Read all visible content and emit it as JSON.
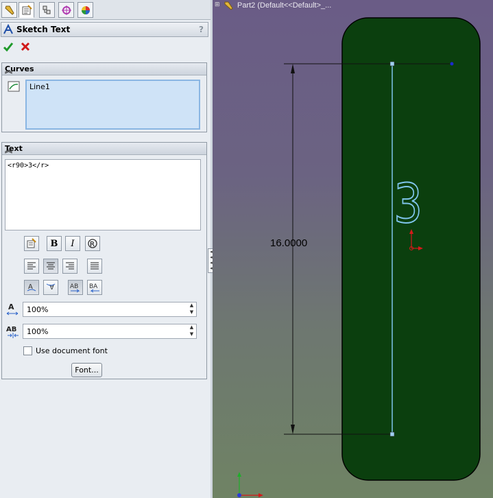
{
  "tabs": [
    {
      "icon": "feature-manager-icon"
    },
    {
      "icon": "property-manager-icon"
    },
    {
      "icon": "configuration-manager-icon"
    },
    {
      "icon": "dimxpert-icon"
    },
    {
      "icon": "display-manager-icon"
    }
  ],
  "property_manager": {
    "title": "Sketch Text",
    "help": "?"
  },
  "curves": {
    "header": "Curves",
    "items": [
      "Line1"
    ]
  },
  "text": {
    "header": "Text",
    "content": "<r90>3</r>",
    "char_height": "100%",
    "char_spacing": "100%",
    "use_document_font_label": "Use document font",
    "use_document_font_checked": false,
    "font_button": "Font..."
  },
  "viewport": {
    "title": "Part2  (Default<<Default>_...",
    "dimension": "16.0000",
    "sketch_text": "3"
  },
  "colors": {
    "part_fill": "#0b3f0e",
    "sketch_line": "#7fc4ea",
    "bg_top": "#6a5c86",
    "bg_bottom": "#6f8364"
  }
}
